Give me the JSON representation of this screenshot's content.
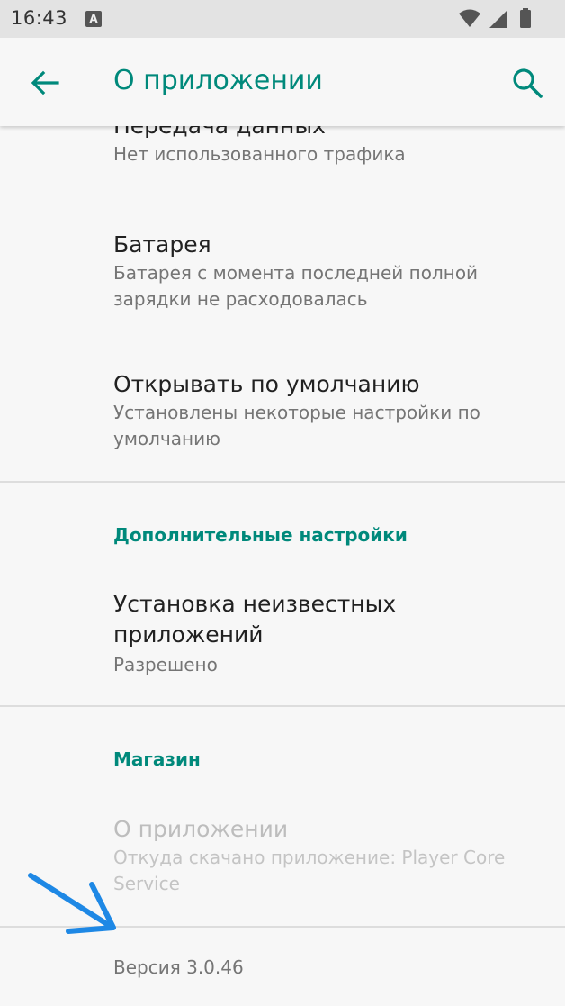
{
  "status_bar": {
    "time": "16:43",
    "notification_icon": "a-icon",
    "icons": [
      "wifi-icon",
      "signal-icon",
      "battery-icon"
    ]
  },
  "app_bar": {
    "title": "О приложении",
    "back_icon": "arrow-left-icon",
    "search_icon": "search-icon"
  },
  "preferences": [
    {
      "title": "Передача данных",
      "summary": "Нет использованного трафика"
    },
    {
      "title": "Батарея",
      "summary": "Батарея с момента последней полной зарядки не расходовалась"
    },
    {
      "title": "Открывать по умолчанию",
      "summary": "Установлены некоторые настройки по умолчанию"
    }
  ],
  "advanced": {
    "category": "Дополнительные настройки",
    "install_unknown": {
      "title": "Установка неизвестных приложений",
      "summary": "Разрешено"
    }
  },
  "store": {
    "category": "Магазин",
    "app_details": {
      "title": "О приложении",
      "summary": "Откуда скачано приложение: Player Core Service"
    }
  },
  "version": "Версия 3.0.46",
  "colors": {
    "accent": "#00897b",
    "annotation_arrow": "#1e88e5"
  }
}
